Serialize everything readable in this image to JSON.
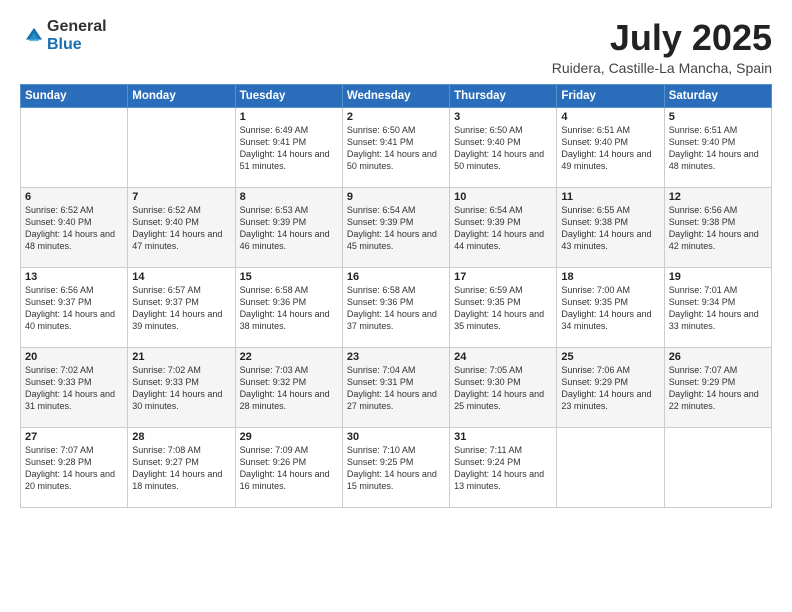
{
  "logo": {
    "general": "General",
    "blue": "Blue"
  },
  "title": "July 2025",
  "subtitle": "Ruidera, Castille-La Mancha, Spain",
  "headers": [
    "Sunday",
    "Monday",
    "Tuesday",
    "Wednesday",
    "Thursday",
    "Friday",
    "Saturday"
  ],
  "weeks": [
    [
      {
        "day": "",
        "info": ""
      },
      {
        "day": "",
        "info": ""
      },
      {
        "day": "1",
        "info": "Sunrise: 6:49 AM\nSunset: 9:41 PM\nDaylight: 14 hours and 51 minutes."
      },
      {
        "day": "2",
        "info": "Sunrise: 6:50 AM\nSunset: 9:41 PM\nDaylight: 14 hours and 50 minutes."
      },
      {
        "day": "3",
        "info": "Sunrise: 6:50 AM\nSunset: 9:40 PM\nDaylight: 14 hours and 50 minutes."
      },
      {
        "day": "4",
        "info": "Sunrise: 6:51 AM\nSunset: 9:40 PM\nDaylight: 14 hours and 49 minutes."
      },
      {
        "day": "5",
        "info": "Sunrise: 6:51 AM\nSunset: 9:40 PM\nDaylight: 14 hours and 48 minutes."
      }
    ],
    [
      {
        "day": "6",
        "info": "Sunrise: 6:52 AM\nSunset: 9:40 PM\nDaylight: 14 hours and 48 minutes."
      },
      {
        "day": "7",
        "info": "Sunrise: 6:52 AM\nSunset: 9:40 PM\nDaylight: 14 hours and 47 minutes."
      },
      {
        "day": "8",
        "info": "Sunrise: 6:53 AM\nSunset: 9:39 PM\nDaylight: 14 hours and 46 minutes."
      },
      {
        "day": "9",
        "info": "Sunrise: 6:54 AM\nSunset: 9:39 PM\nDaylight: 14 hours and 45 minutes."
      },
      {
        "day": "10",
        "info": "Sunrise: 6:54 AM\nSunset: 9:39 PM\nDaylight: 14 hours and 44 minutes."
      },
      {
        "day": "11",
        "info": "Sunrise: 6:55 AM\nSunset: 9:38 PM\nDaylight: 14 hours and 43 minutes."
      },
      {
        "day": "12",
        "info": "Sunrise: 6:56 AM\nSunset: 9:38 PM\nDaylight: 14 hours and 42 minutes."
      }
    ],
    [
      {
        "day": "13",
        "info": "Sunrise: 6:56 AM\nSunset: 9:37 PM\nDaylight: 14 hours and 40 minutes."
      },
      {
        "day": "14",
        "info": "Sunrise: 6:57 AM\nSunset: 9:37 PM\nDaylight: 14 hours and 39 minutes."
      },
      {
        "day": "15",
        "info": "Sunrise: 6:58 AM\nSunset: 9:36 PM\nDaylight: 14 hours and 38 minutes."
      },
      {
        "day": "16",
        "info": "Sunrise: 6:58 AM\nSunset: 9:36 PM\nDaylight: 14 hours and 37 minutes."
      },
      {
        "day": "17",
        "info": "Sunrise: 6:59 AM\nSunset: 9:35 PM\nDaylight: 14 hours and 35 minutes."
      },
      {
        "day": "18",
        "info": "Sunrise: 7:00 AM\nSunset: 9:35 PM\nDaylight: 14 hours and 34 minutes."
      },
      {
        "day": "19",
        "info": "Sunrise: 7:01 AM\nSunset: 9:34 PM\nDaylight: 14 hours and 33 minutes."
      }
    ],
    [
      {
        "day": "20",
        "info": "Sunrise: 7:02 AM\nSunset: 9:33 PM\nDaylight: 14 hours and 31 minutes."
      },
      {
        "day": "21",
        "info": "Sunrise: 7:02 AM\nSunset: 9:33 PM\nDaylight: 14 hours and 30 minutes."
      },
      {
        "day": "22",
        "info": "Sunrise: 7:03 AM\nSunset: 9:32 PM\nDaylight: 14 hours and 28 minutes."
      },
      {
        "day": "23",
        "info": "Sunrise: 7:04 AM\nSunset: 9:31 PM\nDaylight: 14 hours and 27 minutes."
      },
      {
        "day": "24",
        "info": "Sunrise: 7:05 AM\nSunset: 9:30 PM\nDaylight: 14 hours and 25 minutes."
      },
      {
        "day": "25",
        "info": "Sunrise: 7:06 AM\nSunset: 9:29 PM\nDaylight: 14 hours and 23 minutes."
      },
      {
        "day": "26",
        "info": "Sunrise: 7:07 AM\nSunset: 9:29 PM\nDaylight: 14 hours and 22 minutes."
      }
    ],
    [
      {
        "day": "27",
        "info": "Sunrise: 7:07 AM\nSunset: 9:28 PM\nDaylight: 14 hours and 20 minutes."
      },
      {
        "day": "28",
        "info": "Sunrise: 7:08 AM\nSunset: 9:27 PM\nDaylight: 14 hours and 18 minutes."
      },
      {
        "day": "29",
        "info": "Sunrise: 7:09 AM\nSunset: 9:26 PM\nDaylight: 14 hours and 16 minutes."
      },
      {
        "day": "30",
        "info": "Sunrise: 7:10 AM\nSunset: 9:25 PM\nDaylight: 14 hours and 15 minutes."
      },
      {
        "day": "31",
        "info": "Sunrise: 7:11 AM\nSunset: 9:24 PM\nDaylight: 14 hours and 13 minutes."
      },
      {
        "day": "",
        "info": ""
      },
      {
        "day": "",
        "info": ""
      }
    ]
  ]
}
